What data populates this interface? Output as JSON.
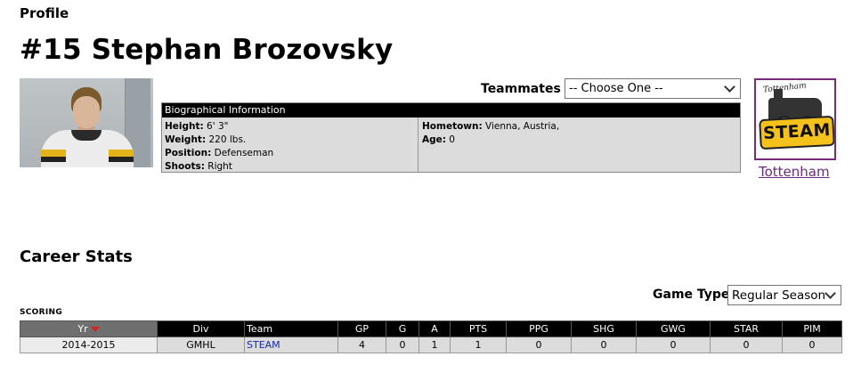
{
  "profile_heading": "Profile",
  "player": {
    "title": "#15 Stephan Brozovsky",
    "photo_alt": "player-photo"
  },
  "teammates": {
    "label": "Teammates",
    "selected": "-- Choose One --"
  },
  "bio": {
    "header": "Biographical Information",
    "left": [
      {
        "key": "Height:",
        "value": " 6' 3\""
      },
      {
        "key": "Weight:",
        "value": " 220 lbs."
      },
      {
        "key": "Position:",
        "value": " Defenseman"
      },
      {
        "key": "Shoots:",
        "value": " Right"
      }
    ],
    "right": [
      {
        "key": "Hometown:",
        "value": " Vienna, Austria,"
      },
      {
        "key": "Age:",
        "value": " 0"
      }
    ]
  },
  "team": {
    "logo_script": "Tottenham",
    "logo_word": "STEAM",
    "link": "Tottenham"
  },
  "career": {
    "heading": "Career Stats",
    "game_type_label": "Game Type",
    "game_type_selected": "Regular Season",
    "scoring_label": "SCORING",
    "columns": [
      "Yr",
      "Div",
      "Team",
      "GP",
      "G",
      "A",
      "PTS",
      "PPG",
      "SHG",
      "GWG",
      "STAR",
      "PIM"
    ],
    "rows": [
      [
        "2014-2015",
        "GMHL",
        "STEAM",
        "4",
        "0",
        "1",
        "1",
        "0",
        "0",
        "0",
        "0",
        "0"
      ]
    ]
  },
  "colors": {
    "header_black": "#000000",
    "bio_gray": "#dcdcdc",
    "logo_border": "#7a2a7a",
    "link_purple": "#6a2a7e",
    "team_link_blue": "#1a2aa0",
    "sort_arrow": "#d92020"
  },
  "icons": {
    "teammates_dropdown": "chevron-down-icon",
    "gametype_dropdown": "chevron-down-icon",
    "sort": "sort-desc-arrow-icon"
  }
}
